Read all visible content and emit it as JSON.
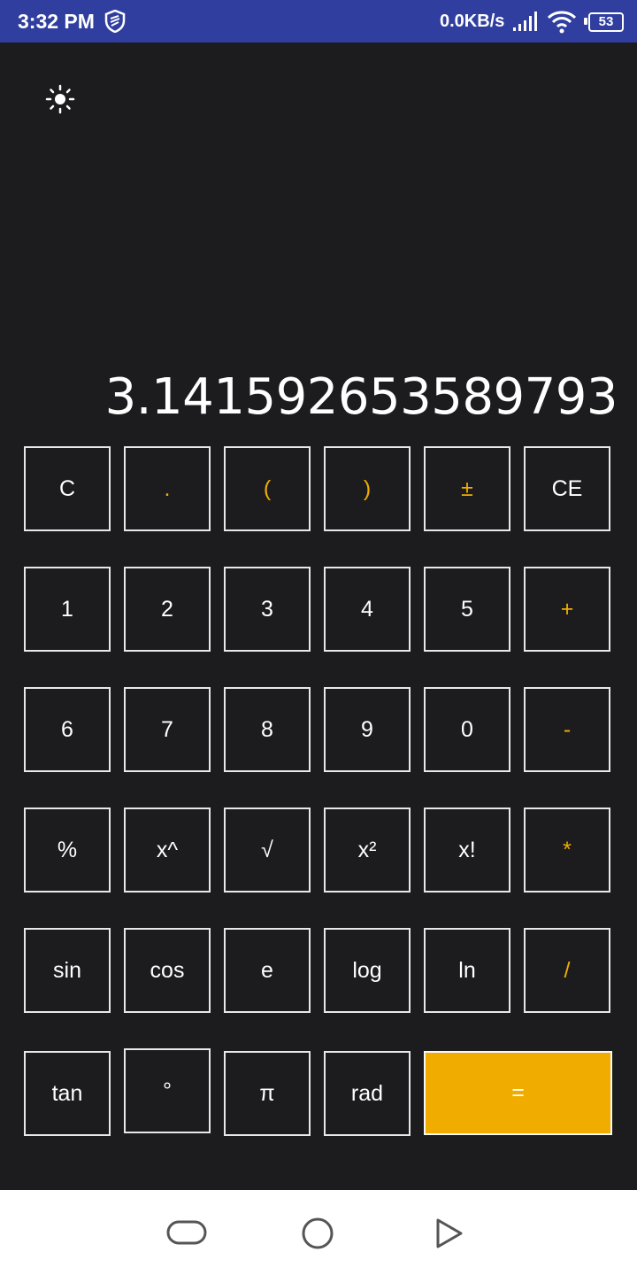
{
  "status_bar": {
    "time": "3:32 PM",
    "net_speed": "0.0KB/s",
    "battery_level": "53",
    "icons": [
      "shield-icon",
      "signal-icon",
      "wifi-icon",
      "battery-icon"
    ]
  },
  "theme_toggle": {
    "icon": "sun-icon"
  },
  "display": {
    "value": "3.141592653589793"
  },
  "keypad": {
    "rows": [
      [
        "C",
        ".",
        "(",
        ")",
        "±",
        "CE"
      ],
      [
        "1",
        "2",
        "3",
        "4",
        "5",
        "+"
      ],
      [
        "6",
        "7",
        "8",
        "9",
        "0",
        "-"
      ],
      [
        "%",
        "x^",
        "√",
        "x²",
        "x!",
        "*"
      ],
      [
        "sin",
        "cos",
        "e",
        "log",
        "ln",
        "/"
      ],
      [
        "tan",
        "°",
        "π",
        "rad",
        "="
      ]
    ]
  },
  "colors": {
    "background": "#1c1c1e",
    "status_bar": "#303f9f",
    "accent": "#f0ad00",
    "key_border": "#e8e8e8",
    "text": "#ffffff",
    "nav_bar": "#ffffff"
  },
  "nav_bar": {
    "icons": [
      "back-icon",
      "home-icon",
      "recents-icon"
    ]
  }
}
